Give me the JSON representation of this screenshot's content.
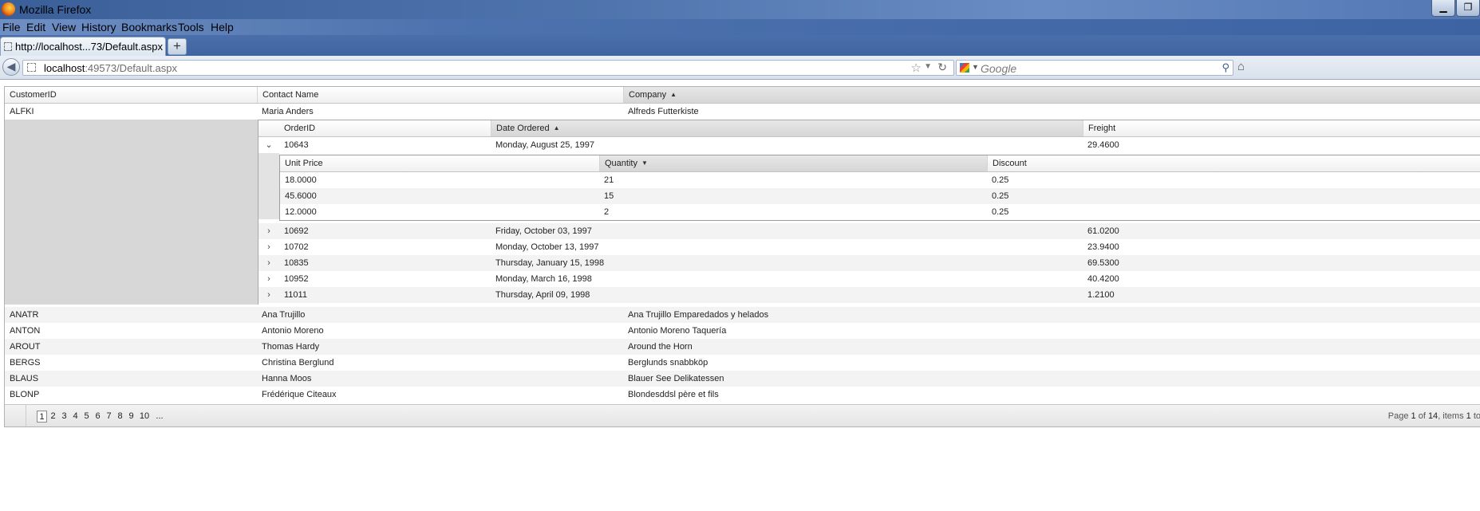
{
  "window": {
    "title": "Mozilla Firefox",
    "minimize_label": "▁",
    "maximize_label": "❐"
  },
  "menu": [
    {
      "label": "File"
    },
    {
      "label": "Edit"
    },
    {
      "label": "View"
    },
    {
      "label": "History"
    },
    {
      "label": "Bookmarks"
    },
    {
      "label": "Tools"
    },
    {
      "label": "Help"
    }
  ],
  "tabs": [
    {
      "label": "http://localhost...73/Default.aspx"
    }
  ],
  "new_tab_label": "+",
  "nav": {
    "url_host": "localhost",
    "url_rest": ":49573/Default.aspx",
    "search_placeholder": "Google"
  },
  "grid": {
    "columns": [
      "CustomerID",
      "Contact Name",
      "Company"
    ],
    "sorted_column": "Company",
    "rows": [
      {
        "id": "ALFKI",
        "contact": "Maria Anders",
        "company": "Alfreds Futterkiste"
      },
      {
        "id": "ANATR",
        "contact": "Ana Trujillo",
        "company": "Ana Trujillo Emparedados y helados"
      },
      {
        "id": "ANTON",
        "contact": "Antonio Moreno",
        "company": "Antonio Moreno Taquería"
      },
      {
        "id": "AROUT",
        "contact": "Thomas Hardy",
        "company": "Around the Horn"
      },
      {
        "id": "BERGS",
        "contact": "Christina Berglund",
        "company": "Berglunds snabbköp"
      },
      {
        "id": "BLAUS",
        "contact": "Hanna Moos",
        "company": "Blauer See Delikatessen"
      },
      {
        "id": "BLONP",
        "contact": "Frédérique Citeaux",
        "company": "Blondesddsl père et fils"
      }
    ],
    "orders": {
      "columns": [
        "OrderID",
        "Date Ordered",
        "Freight"
      ],
      "sorted_column": "Date Ordered",
      "rows": [
        {
          "id": "10643",
          "date": "Monday, August 25, 1997",
          "freight": "29.4600",
          "expanded": true
        },
        {
          "id": "10692",
          "date": "Friday, October 03, 1997",
          "freight": "61.0200",
          "expanded": false
        },
        {
          "id": "10702",
          "date": "Monday, October 13, 1997",
          "freight": "23.9400",
          "expanded": false
        },
        {
          "id": "10835",
          "date": "Thursday, January 15, 1998",
          "freight": "69.5300",
          "expanded": false
        },
        {
          "id": "10952",
          "date": "Monday, March 16, 1998",
          "freight": "40.4200",
          "expanded": false
        },
        {
          "id": "11011",
          "date": "Thursday, April 09, 1998",
          "freight": "1.2100",
          "expanded": false
        }
      ]
    },
    "details": {
      "columns": [
        "Unit Price",
        "Quantity",
        "Discount"
      ],
      "sorted_column": "Quantity",
      "rows": [
        {
          "price": "18.0000",
          "qty": "21",
          "discount": "0.25"
        },
        {
          "price": "45.6000",
          "qty": "15",
          "discount": "0.25"
        },
        {
          "price": "12.0000",
          "qty": "2",
          "discount": "0.25"
        }
      ]
    }
  },
  "pager": {
    "pages": [
      "1",
      "2",
      "3",
      "4",
      "5",
      "6",
      "7",
      "8",
      "9",
      "10",
      "..."
    ],
    "current": "1",
    "info_prefix": "Page ",
    "info_page": "1",
    "info_mid": " of ",
    "info_total": "14",
    "info_items": ", items ",
    "info_items_start": "1",
    "info_suffix": " to"
  }
}
